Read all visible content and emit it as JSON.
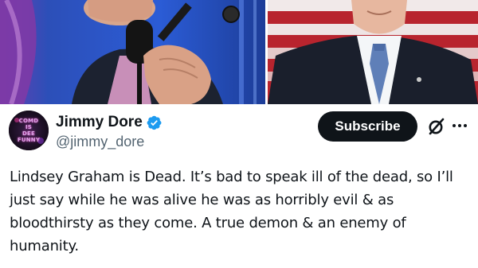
{
  "author": {
    "display_name": "Jimmy Dore",
    "handle": "@jimmy_dore",
    "verified_icon": "verified-badge-icon",
    "avatar_text": [
      "COMD",
      "IS",
      "DEE",
      "FUNNY"
    ]
  },
  "actions": {
    "subscribe_label": "Subscribe",
    "grok_icon": "grok-slash-icon",
    "more_icon": "more-dots-icon"
  },
  "tweet": {
    "text": "Lindsey Graham is Dead. It’s bad to speak ill of the dead, so I’ll just say while he was alive he was as horribly evil & as bloodthirsty as they come. A true demon & an enemy of humanity."
  },
  "colors": {
    "text_primary": "#0f1419",
    "text_secondary": "#536471",
    "verified_blue": "#1d9bf0",
    "button_bg": "#0f1419"
  }
}
